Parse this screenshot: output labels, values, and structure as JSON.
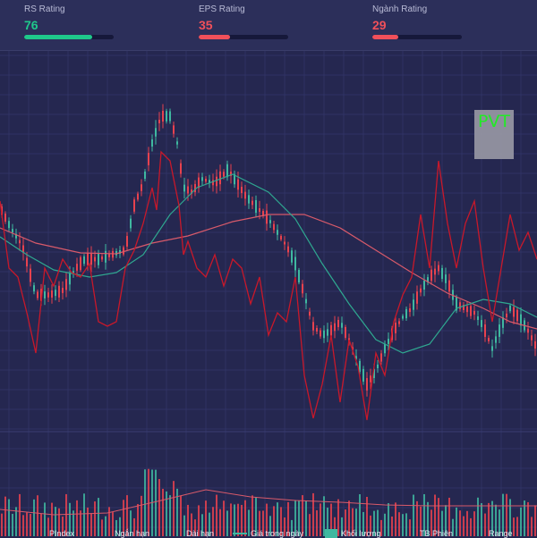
{
  "ratings": [
    {
      "label": "RS Rating",
      "value": "76",
      "level": 0.76,
      "color": "#1fc98b"
    },
    {
      "label": "EPS Rating",
      "value": "35",
      "level": 0.35,
      "color": "#f0505a"
    },
    {
      "label": "Ngành Rating",
      "value": "29",
      "level": 0.29,
      "color": "#f0505a"
    }
  ],
  "ticker": "PVT",
  "legend": {
    "pindex": "PIndex",
    "ngan_han": "Ngắn hạn",
    "dai_han": "Dài hạn",
    "gia_trong_ngay": "Giá trong ngày",
    "khoi_luong": "Khối lượng",
    "tb_phien": "TB Phiên",
    "range": "Range"
  },
  "colors": {
    "up": "#3fb8a0",
    "down": "#e8424e",
    "pindex": "#c8182a",
    "short_ma": "#2fa890",
    "long_ma": "#d85a6a",
    "grid": "#33376a"
  }
}
